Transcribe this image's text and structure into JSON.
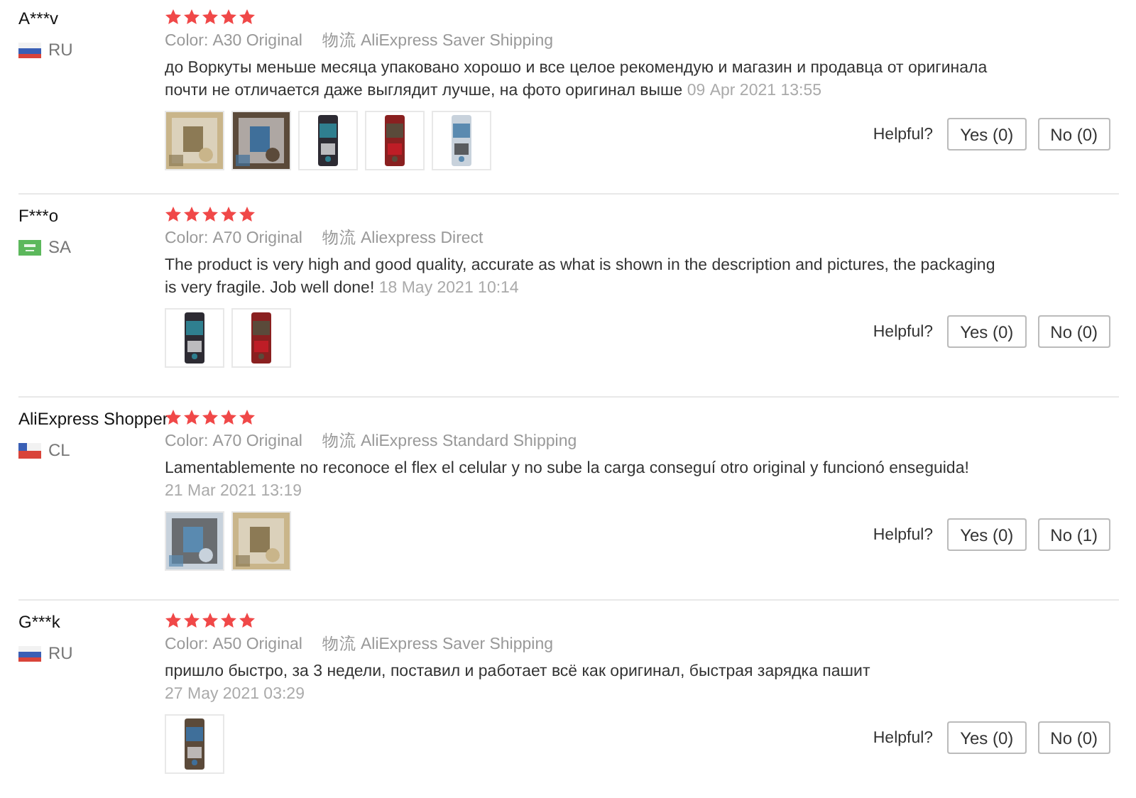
{
  "reviews": [
    {
      "name": "A***v",
      "country": "RU",
      "flag": {
        "kind": "russia"
      },
      "stars": 5,
      "color_label": "Color:",
      "color_value": "A30 Original",
      "shipping_label": "物流",
      "shipping": "AliExpress Saver Shipping",
      "text": "до Воркуты меньше месяца упаковано хорошо и все целое рекомендую и магазин и продавца от оригинала почти не отличается даже выглядит лучше, на фото оригинал выше",
      "date": "09 Apr 2021 13:55",
      "photos": [
        {
          "kind": "picture"
        },
        {
          "kind": "picture"
        },
        {
          "kind": "picture"
        },
        {
          "kind": "picture"
        },
        {
          "kind": "picture"
        }
      ],
      "helpful": "Helpful?",
      "yes": "Yes (0)",
      "no": "No (0)"
    },
    {
      "name": "F***o",
      "country": "SA",
      "flag": {
        "kind": "saudi"
      },
      "stars": 5,
      "color_label": "Color:",
      "color_value": "A70 Original",
      "shipping_label": "物流",
      "shipping": "Aliexpress Direct",
      "text": "The product is very high and good quality, accurate as what is shown in the description and pictures, the packaging is very fragile. Job well done!",
      "date": "18 May 2021 10:14",
      "photos": [
        {
          "kind": "picture"
        },
        {
          "kind": "picture"
        }
      ],
      "helpful": "Helpful?",
      "yes": "Yes (0)",
      "no": "No (0)"
    },
    {
      "name": "AliExpress Shopper",
      "country": "CL",
      "flag": {
        "kind": "chile"
      },
      "stars": 5,
      "color_label": "Color:",
      "color_value": "A70 Original",
      "shipping_label": "物流",
      "shipping": "AliExpress Standard Shipping",
      "text": "Lamentablemente no reconoce el flex el celular y no sube la carga conseguí otro original y funcionó enseguida!",
      "date": "21 Mar 2021 13:19",
      "photos": [
        {
          "kind": "picture"
        },
        {
          "kind": "picture"
        }
      ],
      "helpful": "Helpful?",
      "yes": "Yes (0)",
      "no": "No (1)"
    },
    {
      "name": "G***k",
      "country": "RU",
      "flag": {
        "kind": "russia"
      },
      "stars": 5,
      "color_label": "Color:",
      "color_value": "A50 Original",
      "shipping_label": "物流",
      "shipping": "AliExpress Saver Shipping",
      "text": "пришло быстро, за 3 недели, поставил и работает всё как оригинал, быстрая зарядка пашит",
      "date": "27 May 2021 03:29",
      "photos": [
        {
          "kind": "picture"
        }
      ],
      "helpful": "Helpful?",
      "yes": "Yes (0)",
      "no": "No (0)"
    }
  ]
}
